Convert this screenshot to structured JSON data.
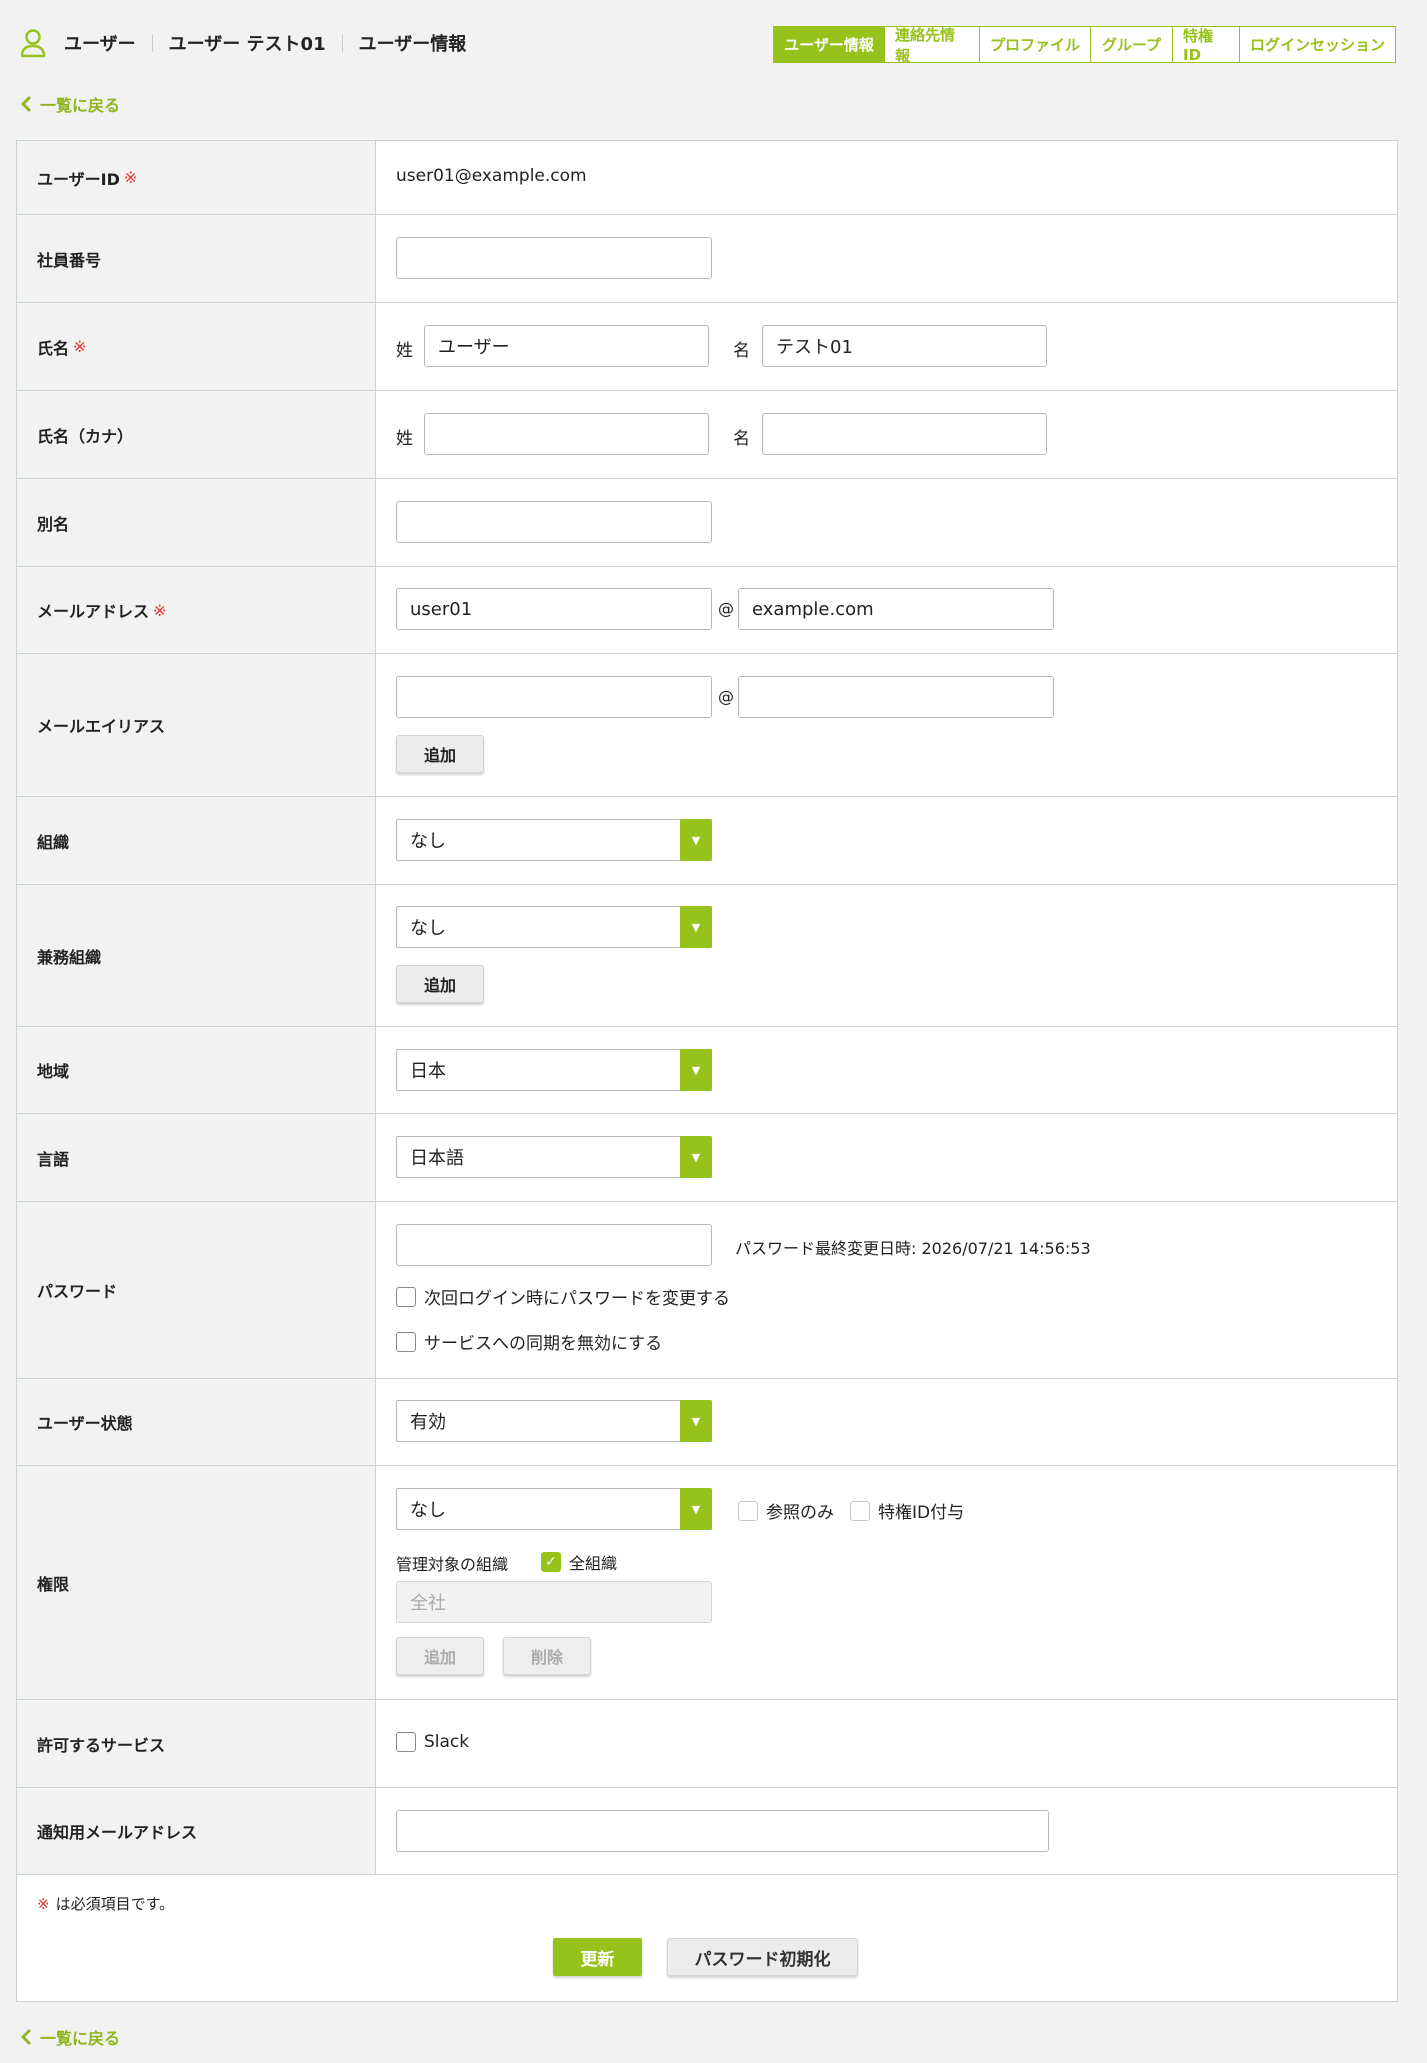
{
  "header": {
    "breadcrumb": [
      "ユーザー",
      "ユーザー テスト01",
      "ユーザー情報"
    ],
    "tabs": [
      "ユーザー情報",
      "連絡先情報",
      "プロファイル",
      "グループ",
      "特権ID",
      "ログインセッション"
    ],
    "active_tab": "ユーザー情報",
    "back_label": "一覧に戻る"
  },
  "colors": {
    "accent": "#96c21c",
    "required": "#e0352b"
  },
  "required_mark": "※",
  "fields": {
    "user_id": {
      "label": "ユーザーID",
      "value": "user01@example.com"
    },
    "employee_no": {
      "label": "社員番号",
      "value": ""
    },
    "name": {
      "label": "氏名",
      "last_label": "姓",
      "last_value": "ユーザー",
      "first_label": "名",
      "first_value": "テスト01"
    },
    "name_kana": {
      "label": "氏名（カナ）",
      "last_label": "姓",
      "last_value": "",
      "first_label": "名",
      "first_value": ""
    },
    "alias": {
      "label": "別名",
      "value": ""
    },
    "email": {
      "label": "メールアドレス",
      "local": "user01",
      "at": "@",
      "domain": "example.com"
    },
    "email_alias": {
      "label": "メールエイリアス",
      "local": "",
      "at": "@",
      "domain": "",
      "add_label": "追加"
    },
    "org": {
      "label": "組織",
      "selected": "なし"
    },
    "concurrent_org": {
      "label": "兼務組織",
      "selected": "なし",
      "add_label": "追加"
    },
    "region": {
      "label": "地域",
      "selected": "日本"
    },
    "language": {
      "label": "言語",
      "selected": "日本語"
    },
    "password": {
      "label": "パスワード",
      "value": "",
      "last_changed": "パスワード最終変更日時: 2026/07/21 14:56:53",
      "change_next_login": "次回ログイン時にパスワードを変更する",
      "disable_sync": "サービスへの同期を無効にする"
    },
    "status": {
      "label": "ユーザー状態",
      "selected": "有効"
    },
    "permission": {
      "label": "権限",
      "selected": "なし",
      "readonly_label": "参照のみ",
      "privileged_label": "特権ID付与",
      "managed_org_label": "管理対象の組織",
      "all_orgs_label": "全組織",
      "all_orgs_checked": true,
      "org_list_item": "全社",
      "add_label": "追加",
      "delete_label": "削除"
    },
    "services": {
      "label": "許可するサービス",
      "slack_label": "Slack"
    },
    "notify_email": {
      "label": "通知用メールアドレス",
      "value": ""
    }
  },
  "footer": {
    "required_note": "は必須項目です。",
    "update_label": "更新",
    "reset_password_label": "パスワード初期化"
  }
}
